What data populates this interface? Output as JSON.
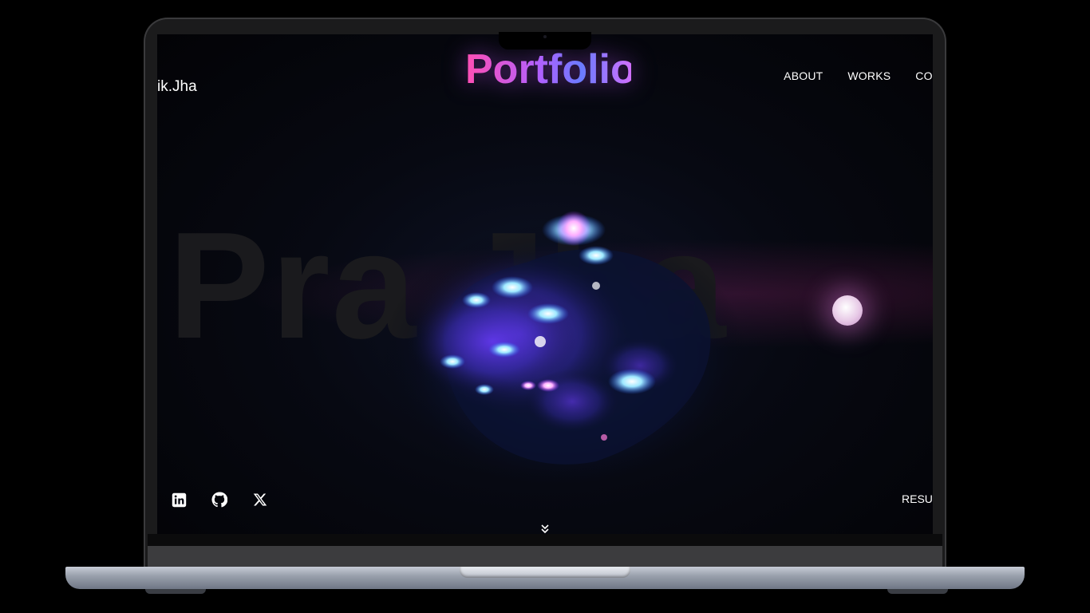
{
  "site": {
    "logo_text": "ik.Jha",
    "hero_title": "Portfolio",
    "background_name": "Pra       Jha"
  },
  "nav": {
    "items": [
      "ABOUT",
      "WORKS",
      "CON"
    ]
  },
  "socials": [
    {
      "name": "linkedin-icon"
    },
    {
      "name": "github-icon"
    },
    {
      "name": "x-icon"
    }
  ],
  "resume_label": "RESUI",
  "colors": {
    "title_gradient": [
      "#ff4fb4",
      "#b060ff",
      "#6a7bff"
    ],
    "screen_bg": "#070912",
    "orb_glow": "#7fe3ff"
  }
}
